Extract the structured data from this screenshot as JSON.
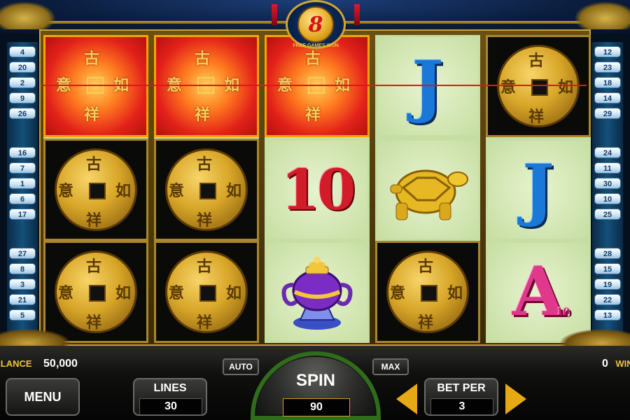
{
  "top_badge": {
    "free_games": "8",
    "caption": "FREE GAMES WON"
  },
  "left_lines": [
    "4",
    "20",
    "2",
    "9",
    "26",
    "16",
    "7",
    "1",
    "6",
    "17",
    "27",
    "8",
    "3",
    "21",
    "5"
  ],
  "right_lines": [
    "12",
    "23",
    "18",
    "14",
    "29",
    "24",
    "11",
    "30",
    "10",
    "25",
    "28",
    "15",
    "19",
    "22",
    "13"
  ],
  "reels": [
    [
      "coin-red",
      "coin",
      "coin"
    ],
    [
      "coin-red",
      "coin",
      "coin"
    ],
    [
      "coin-red",
      "10",
      "urn"
    ],
    [
      "J",
      "turtle",
      "coin"
    ],
    [
      "coin",
      "J",
      "A"
    ]
  ],
  "symbols": {
    "ten": "10",
    "jack": "J",
    "ace": "A",
    "ace_sup": "10",
    "coin_chars": [
      "古",
      "如",
      "意",
      "祥"
    ]
  },
  "footer": {
    "balance_label": "BALANCE",
    "balance_value": "50,000",
    "win_value": "0",
    "win_label": "WIN",
    "menu_label": "MENU",
    "auto_label": "AUTO",
    "max_label": "MAX",
    "lines_label": "LINES",
    "lines_value": "30",
    "spin_label": "SPIN",
    "spin_value": "90",
    "bet_label": "BET PER",
    "bet_value": "3"
  },
  "colors": {
    "accent_gold": "#f0c23a",
    "payline_red": "#e01717",
    "spin_ring": "#2f6d1a"
  }
}
